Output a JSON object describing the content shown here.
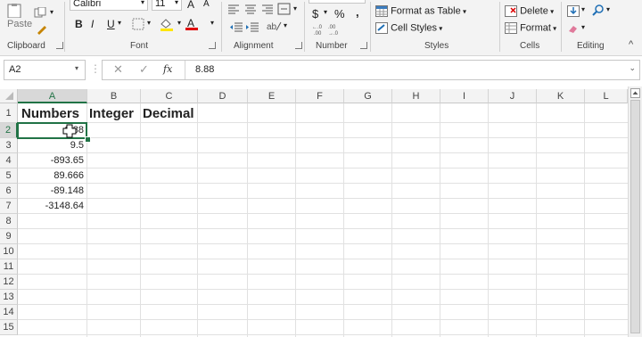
{
  "ribbon": {
    "font_name": "Calibri",
    "font_size": "11",
    "paste_label": "Paste",
    "bold": "B",
    "italic": "I",
    "underline": "U",
    "currency": "$",
    "percent": "%",
    "comma": ",",
    "dec_inc": "←.0 .00",
    "dec_dec": ".00 →.0",
    "format_as_table": "Format as Table",
    "cell_styles": "Cell Styles",
    "delete_label": "Delete",
    "format_label": "Format",
    "groups": {
      "clipboard": "Clipboard",
      "font": "Font",
      "alignment": "Alignment",
      "number": "Number",
      "styles": "Styles",
      "cells": "Cells",
      "editing": "Editing"
    }
  },
  "formula_bar": {
    "name_box": "A2",
    "fx": "fx",
    "value": "8.88"
  },
  "grid": {
    "columns": [
      "A",
      "B",
      "C",
      "D",
      "E",
      "F",
      "G",
      "H",
      "I",
      "J",
      "K",
      "L"
    ],
    "rows": [
      "1",
      "2",
      "3",
      "4",
      "5",
      "6",
      "7",
      "8",
      "9",
      "10",
      "11",
      "12",
      "13",
      "14",
      "15"
    ],
    "headers": {
      "a1": "Numbers",
      "b1": "Integer",
      "c1": "Decimal"
    },
    "a_values": [
      "8.88",
      "9.5",
      "-893.65",
      "89.666",
      "-89.148",
      "-3148.64"
    ]
  },
  "colors": {
    "accent": "#217346",
    "ribbon_bg": "#f3f3f3"
  }
}
